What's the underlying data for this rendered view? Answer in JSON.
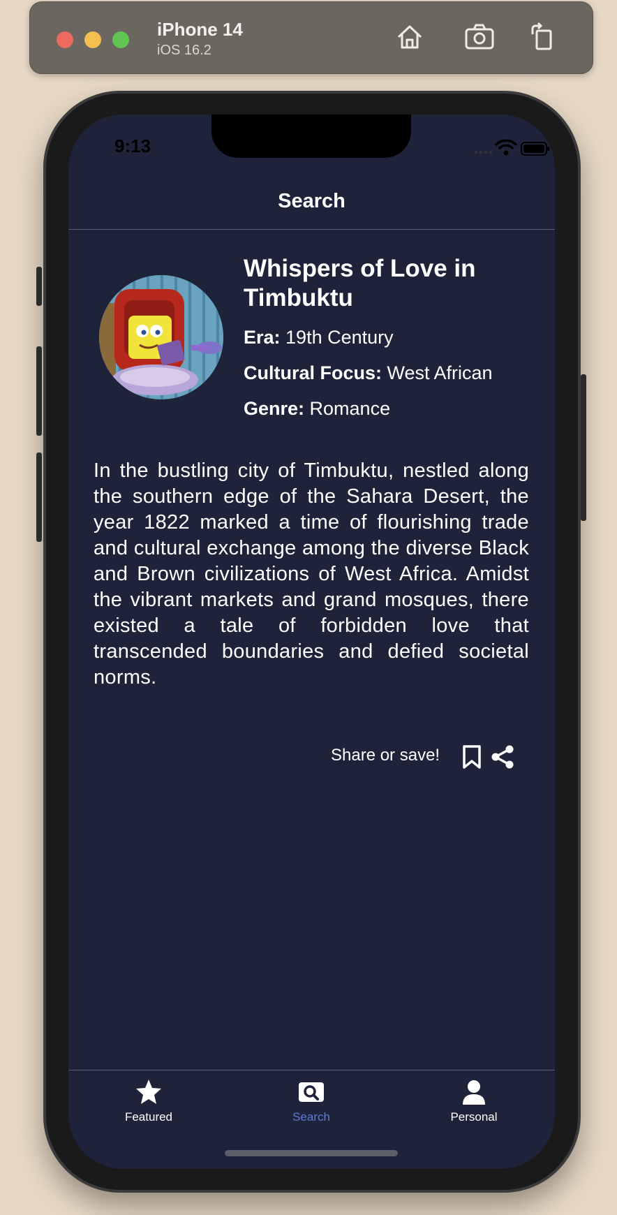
{
  "simulator": {
    "device_name": "iPhone 14",
    "os_version": "iOS 16.2",
    "toolbar_icons": [
      "home-icon",
      "screenshot-icon",
      "rotate-icon"
    ]
  },
  "status_bar": {
    "time": "9:13"
  },
  "nav": {
    "title": "Search"
  },
  "story": {
    "title": "Whispers of Love in Timbuktu",
    "era_label": "Era:",
    "era_value": " 19th Century",
    "focus_label": "Cultural Focus:",
    "focus_value": " West African",
    "genre_label": "Genre:",
    "genre_value": " Romance",
    "body": "In the bustling city of Timbuktu, nestled along the southern edge of the Sahara Desert, the year 1822 marked a time of flourishing trade and cultural exchange among the diverse Black and Brown civilizations of West Africa. Amidst the vibrant markets and grand mosques, there existed a tale of forbidden love that transcended boundaries and defied societal norms.",
    "share_label": "Share or save!"
  },
  "tabs": [
    {
      "label": "Featured",
      "icon": "star-icon",
      "active": false
    },
    {
      "label": "Search",
      "icon": "search-icon",
      "active": true
    },
    {
      "label": "Personal",
      "icon": "person-icon",
      "active": false
    }
  ],
  "colors": {
    "screen_bg": "#1f233a",
    "active_tab": "#5e7ad8",
    "text": "#ffffff"
  }
}
